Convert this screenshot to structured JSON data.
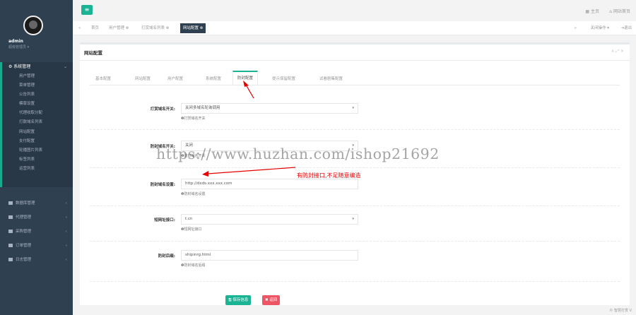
{
  "profile": {
    "name": "admin",
    "role": "超级管理员 ▾"
  },
  "sidebar": {
    "active_group": "系统管理",
    "active_items": [
      "用户管理",
      "菜单管理",
      "公告列表",
      "模版设置",
      "代理收取分配",
      "打款域名列表",
      "网站配置",
      "支付配置",
      "轮播图片列表",
      "标签列表",
      "运营列表"
    ],
    "groups": [
      "数据库管理",
      "代理管理",
      "采购管理",
      "订单管理",
      "日志管理"
    ]
  },
  "topbar": {
    "home": "主页",
    "site_home": "网站首页"
  },
  "tabs": {
    "close_all": "关闭操作 ▾",
    "back": "⇥退出",
    "items": [
      "首页",
      "用户管理 ⊗",
      "打赏域名列表 ⊗",
      "网站配置 ⊗"
    ]
  },
  "panel": {
    "title": "网站配置",
    "tools": "∧ ⤢ ×",
    "nav_tabs": [
      "基本配置",
      "网站配置",
      "用户配置",
      "系统配置",
      "防封配置",
      "提示保留配置",
      "试看剧集配置"
    ],
    "active_tab": "防封配置"
  },
  "form": {
    "f1": {
      "label": "打赏域名开关:",
      "value": "关闭多域名轮询调用",
      "help": "❶打赏域名开关"
    },
    "f2": {
      "label": "防封域名开关:",
      "value": "关闭",
      "help": "❶防封域名开关"
    },
    "f3": {
      "label": "防封域名设置:",
      "value": "http://dxds.xxx.xxx.com",
      "help": "❶防封域名设置"
    },
    "f4": {
      "label": "短网址接口:",
      "value": "t.cn",
      "help": "❶短网址接口"
    },
    "f5": {
      "label": "防封后缀:",
      "value": "shipinrg.html",
      "help": "❶防封域名后缀"
    }
  },
  "buttons": {
    "save": "🖫 保存信息",
    "back": "✖ 返回"
  },
  "watermark": "https://www.huzhan.com/ishop21692",
  "annotation": "有防封接口,不足随意编造",
  "footer": "© 智慧打赏 V",
  "colors": {
    "sidebar": "#2f4050",
    "accent": "#1ab394",
    "danger": "#ed5565",
    "annotation": "#e60000"
  }
}
